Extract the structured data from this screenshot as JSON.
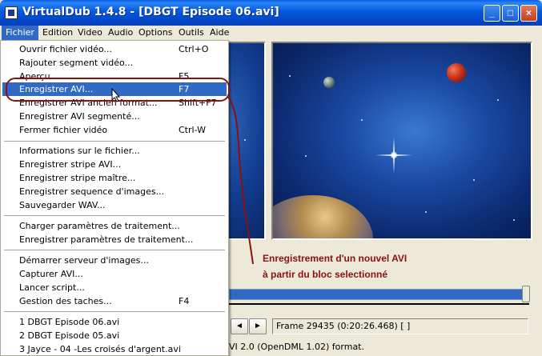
{
  "window": {
    "title": "VirtualDub 1.4.8 - [DBGT Episode 06.avi]"
  },
  "title_buttons": {
    "minimize": "_",
    "maximize": "□",
    "close": "×"
  },
  "menubar": [
    "Fichier",
    "Edition",
    "Video",
    "Audio",
    "Options",
    "Outils",
    "Aide"
  ],
  "file_menu": {
    "groups": [
      [
        {
          "label": "Ouvrir fichier vidéo...",
          "shortcut": "Ctrl+O"
        },
        {
          "label": "Rajouter segment vidéo...",
          "shortcut": ""
        },
        {
          "label": "Aperçu...",
          "shortcut": "F5"
        },
        {
          "label": "Enregistrer AVI...",
          "shortcut": "F7",
          "highlighted": true
        },
        {
          "label": "Enregistrer AVI ancien format...",
          "shortcut": "Shift+F7"
        },
        {
          "label": "Enregistrer AVI segmenté...",
          "shortcut": ""
        },
        {
          "label": "Fermer fichier vidéo",
          "shortcut": "Ctrl-W"
        }
      ],
      [
        {
          "label": "Informations sur le fichier...",
          "shortcut": ""
        },
        {
          "label": "Enregistrer stripe AVI...",
          "shortcut": ""
        },
        {
          "label": "Enregistrer stripe maître...",
          "shortcut": ""
        },
        {
          "label": "Enregistrer sequence d'images...",
          "shortcut": ""
        },
        {
          "label": "Sauvegarder WAV...",
          "shortcut": ""
        }
      ],
      [
        {
          "label": "Charger paramètres de traitement...",
          "shortcut": ""
        },
        {
          "label": "Enregistrer paramètres de traitement...",
          "shortcut": ""
        }
      ],
      [
        {
          "label": "Démarrer serveur d'images...",
          "shortcut": ""
        },
        {
          "label": "Capturer AVI...",
          "shortcut": ""
        },
        {
          "label": "Lancer script...",
          "shortcut": ""
        },
        {
          "label": "Gestion des taches...",
          "shortcut": "F4"
        }
      ],
      [
        {
          "label": "1 DBGT Episode 06.avi",
          "shortcut": ""
        },
        {
          "label": "2 DBGT Episode 05.avi",
          "shortcut": ""
        },
        {
          "label": "3 Jayce - 04 -Les croisés d'argent.avi",
          "shortcut": ""
        }
      ]
    ]
  },
  "annotation": {
    "line1": "Enregistrement d'un nouvel AVI",
    "line2": "à partir du bloc selectionné",
    "color": "#8b1010"
  },
  "frame_readout": "Frame 29435 (0:20:26.468) [ ]",
  "status_text": "VI 2.0 (OpenDML 1.02) format.",
  "nav_buttons": [
    "◄",
    "►"
  ],
  "colors": {
    "titlebar": "#0458dc",
    "highlight": "#316ac5",
    "menu_bg": "#ece9d8"
  }
}
